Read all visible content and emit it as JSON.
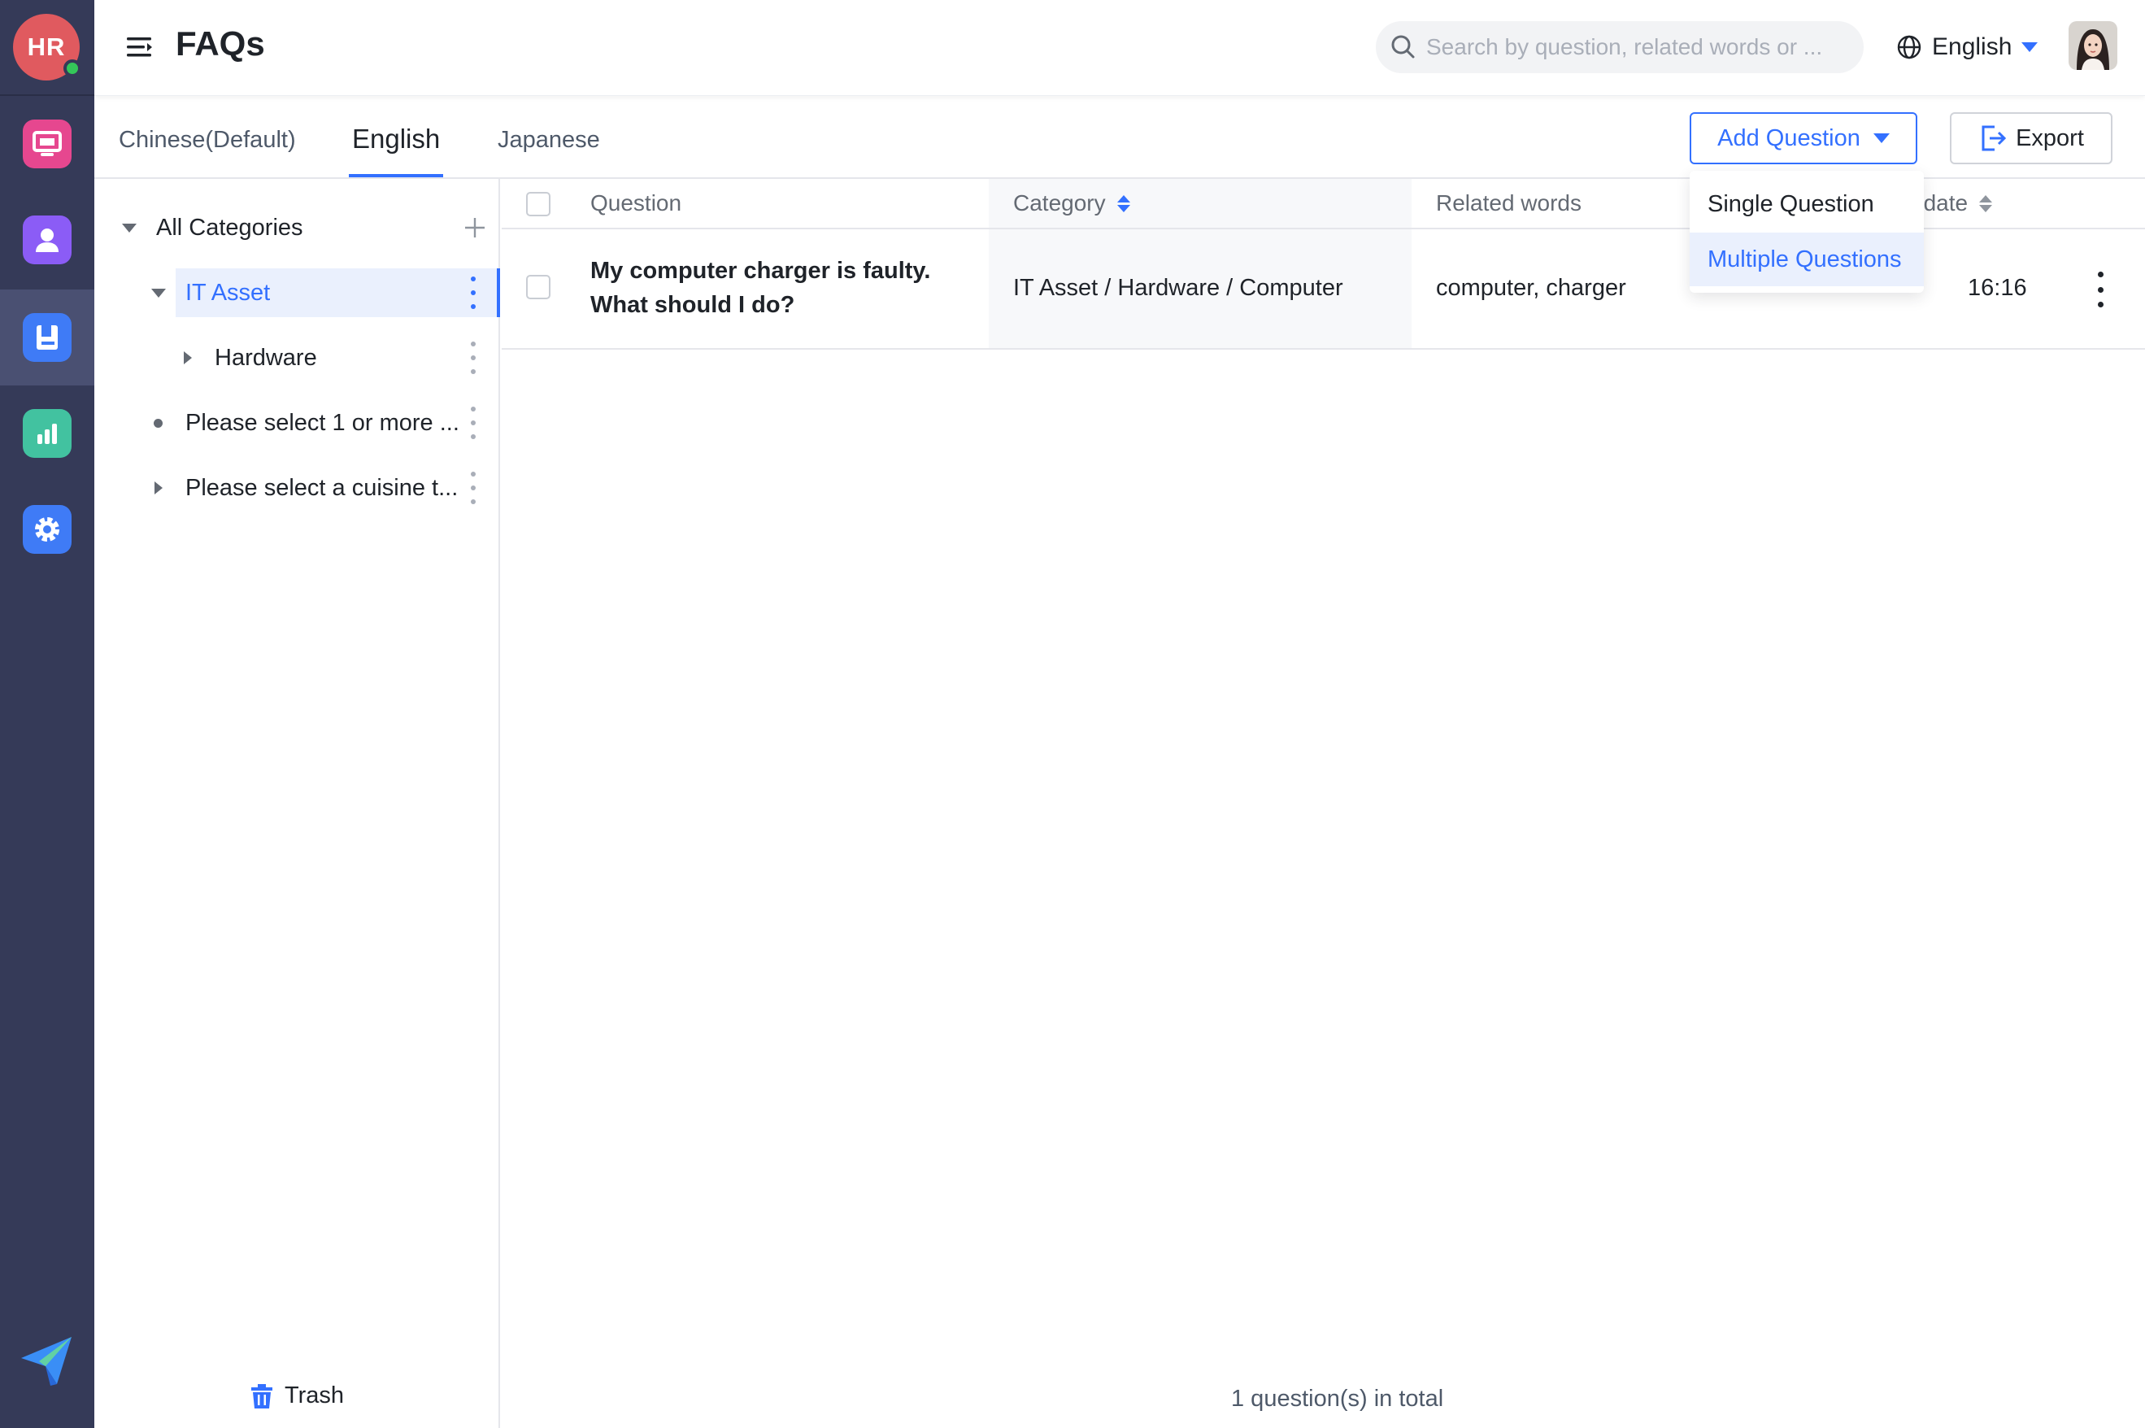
{
  "rail": {
    "logo_text": "HR",
    "items": [
      {
        "icon": "inbox-icon",
        "color": "#e6478f"
      },
      {
        "icon": "user-icon",
        "color": "#8b5cf6"
      },
      {
        "icon": "knowledge-book-icon",
        "color": "#3f7bf6",
        "active": true
      },
      {
        "icon": "bar-chart-icon",
        "color": "#42c2a0"
      },
      {
        "icon": "gear-icon",
        "color": "#3f7bf6"
      }
    ],
    "bottom_icon": "paper-plane-icon"
  },
  "header": {
    "title": "FAQs",
    "search_placeholder": "Search by question, related words or ...",
    "language": "English"
  },
  "tabs": [
    {
      "label": "Chinese(Default)",
      "active": false
    },
    {
      "label": "English",
      "active": true
    },
    {
      "label": "Japanese",
      "active": false
    }
  ],
  "actions": {
    "add_question": "Add Question",
    "export": "Export",
    "add_menu": [
      "Single Question",
      "Multiple Questions"
    ],
    "add_menu_hover": "Multiple Questions"
  },
  "categories": {
    "root": "All Categories",
    "items": [
      {
        "label": "IT Asset",
        "level": 1,
        "expanded": true,
        "selected": true
      },
      {
        "label": "Hardware",
        "level": 2,
        "expanded": false
      },
      {
        "label": "Please select 1 or more ...",
        "level": 1,
        "leaf": true
      },
      {
        "label": "Please select a cuisine t...",
        "level": 1,
        "expanded": false
      }
    ],
    "trash": "Trash"
  },
  "table": {
    "columns": [
      "Question",
      "Category",
      "Related words",
      "pdate"
    ],
    "rows": [
      {
        "question": "My computer charger is faulty. What should I do?",
        "category": "IT Asset / Hardware / Computer",
        "related_words": "computer, charger",
        "last_update": "16:16"
      }
    ],
    "total": "1 question(s) in total"
  },
  "colors": {
    "accent": "#3370ff",
    "rail_bg": "#353a58"
  }
}
